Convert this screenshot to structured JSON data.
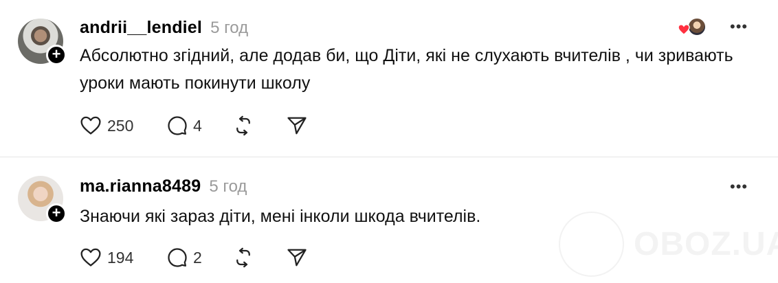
{
  "posts": [
    {
      "username": "andrii__lendiel",
      "time": "5 год",
      "text": "Абсолютно згідний, але додав би, що Діти, які не слухають вчителів , чи зривають уроки мають покинути школу",
      "likes": "250",
      "comments": "4",
      "more": "•••"
    },
    {
      "username": "ma.rianna8489",
      "time": "5 год",
      "text": "Знаючи які зараз діти, мені інколи шкода вчителів.",
      "likes": "194",
      "comments": "2",
      "more": "•••"
    }
  ],
  "follow_symbol": "+",
  "watermark": "OBOZ.UA",
  "icons": {
    "like": "heart-icon",
    "comment": "comment-bubble-icon",
    "repost": "repost-icon",
    "share": "send-icon",
    "more": "more-dots-icon",
    "liked_by": "liked-heart-icon"
  },
  "colors": {
    "liked_heart": "#ff3040",
    "muted": "#9a9a9a",
    "text": "#111111"
  }
}
